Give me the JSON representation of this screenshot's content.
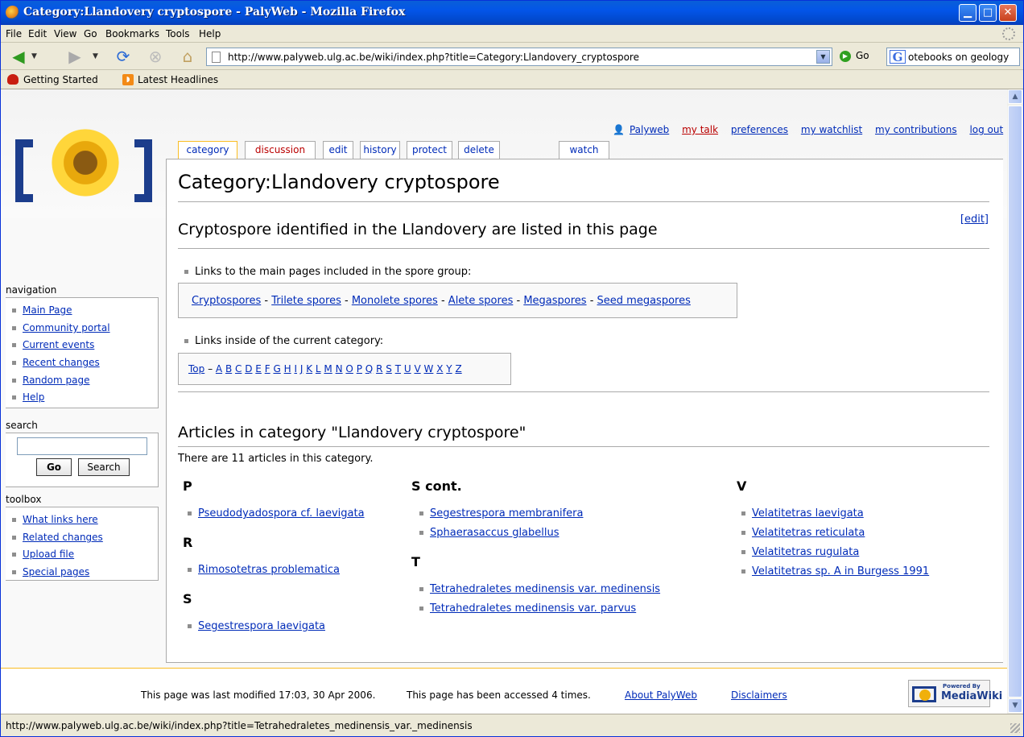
{
  "window": {
    "title": "Category:Llandovery cryptospore - PalyWeb - Mozilla Firefox"
  },
  "menu": [
    "File",
    "Edit",
    "View",
    "Go",
    "Bookmarks",
    "Tools",
    "Help"
  ],
  "toolbar": {
    "url": "http://www.palyweb.ulg.ac.be/wiki/index.php?title=Category:Llandovery_cryptospore",
    "go_label": "Go",
    "search_value": "otebooks on geology"
  },
  "bookmarks": [
    "Getting Started",
    "Latest Headlines"
  ],
  "usertools": {
    "user": "Palyweb",
    "talk": "my talk",
    "preferences": "preferences",
    "watchlist": "my watchlist",
    "contributions": "my contributions",
    "logout": "log out"
  },
  "tabs": [
    "category",
    "discussion",
    "edit",
    "history",
    "protect",
    "delete",
    "watch"
  ],
  "page": {
    "title": "Category:Llandovery cryptospore",
    "section_heading": "Cryptospore identified in the Llandovery are listed in this page",
    "edit_link": "edit",
    "bullet1": "Links to the main pages included in the spore group:",
    "spore_links": [
      "Cryptospores",
      "Trilete spores",
      "Monolete spores",
      "Alete spores",
      "Megaspores",
      "Seed megaspores"
    ],
    "bullet2": "Links inside of the current category:",
    "top_link": "Top",
    "alphabet": [
      "A",
      "B",
      "C",
      "D",
      "E",
      "F",
      "G",
      "H",
      "I",
      "J",
      "K",
      "L",
      "M",
      "N",
      "O",
      "P",
      "Q",
      "R",
      "S",
      "T",
      "U",
      "V",
      "W",
      "X",
      "Y",
      "Z"
    ],
    "articles_heading": "Articles in category \"Llandovery cryptospore\"",
    "count_text": "There are 11 articles in this category.",
    "columns": [
      {
        "groups": [
          {
            "letter": "P",
            "items": [
              "Pseudodyadospora cf. laevigata"
            ]
          },
          {
            "letter": "R",
            "items": [
              "Rimosotetras problematica"
            ]
          },
          {
            "letter": "S",
            "items": [
              "Segestrespora laevigata"
            ]
          }
        ]
      },
      {
        "groups": [
          {
            "letter": "S cont.",
            "items": [
              "Segestrespora membranifera",
              "Sphaerasaccus glabellus"
            ]
          },
          {
            "letter": "T",
            "items": [
              "Tetrahedraletes medinensis var. medinensis",
              "Tetrahedraletes medinensis var. parvus"
            ]
          }
        ]
      },
      {
        "groups": [
          {
            "letter": "V",
            "items": [
              "Velatitetras laevigata",
              "Velatitetras reticulata",
              "Velatitetras rugulata",
              "Velatitetras sp. A in Burgess 1991"
            ]
          }
        ]
      }
    ]
  },
  "sidebar": {
    "navigation_label": "navigation",
    "navigation": [
      "Main Page",
      "Community portal",
      "Current events",
      "Recent changes",
      "Random page",
      "Help"
    ],
    "search_label": "search",
    "go_button": "Go",
    "search_button": "Search",
    "toolbox_label": "toolbox",
    "toolbox": [
      "What links here",
      "Related changes",
      "Upload file",
      "Special pages"
    ]
  },
  "footer": {
    "modified": "This page was last modified 17:03, 30 Apr 2006.",
    "accessed": "This page has been accessed 4 times.",
    "about": "About PalyWeb",
    "disclaimers": "Disclaimers",
    "badge_small": "Powered By",
    "badge_big": "MediaWiki"
  },
  "status": "http://www.palyweb.ulg.ac.be/wiki/index.php?title=Tetrahedraletes_medinensis_var._medinensis",
  "colors": {
    "link": "#002bb8",
    "new_link": "#ba0000",
    "tab_selected_border": "#fabd23",
    "titlebar": "#0355e8"
  }
}
